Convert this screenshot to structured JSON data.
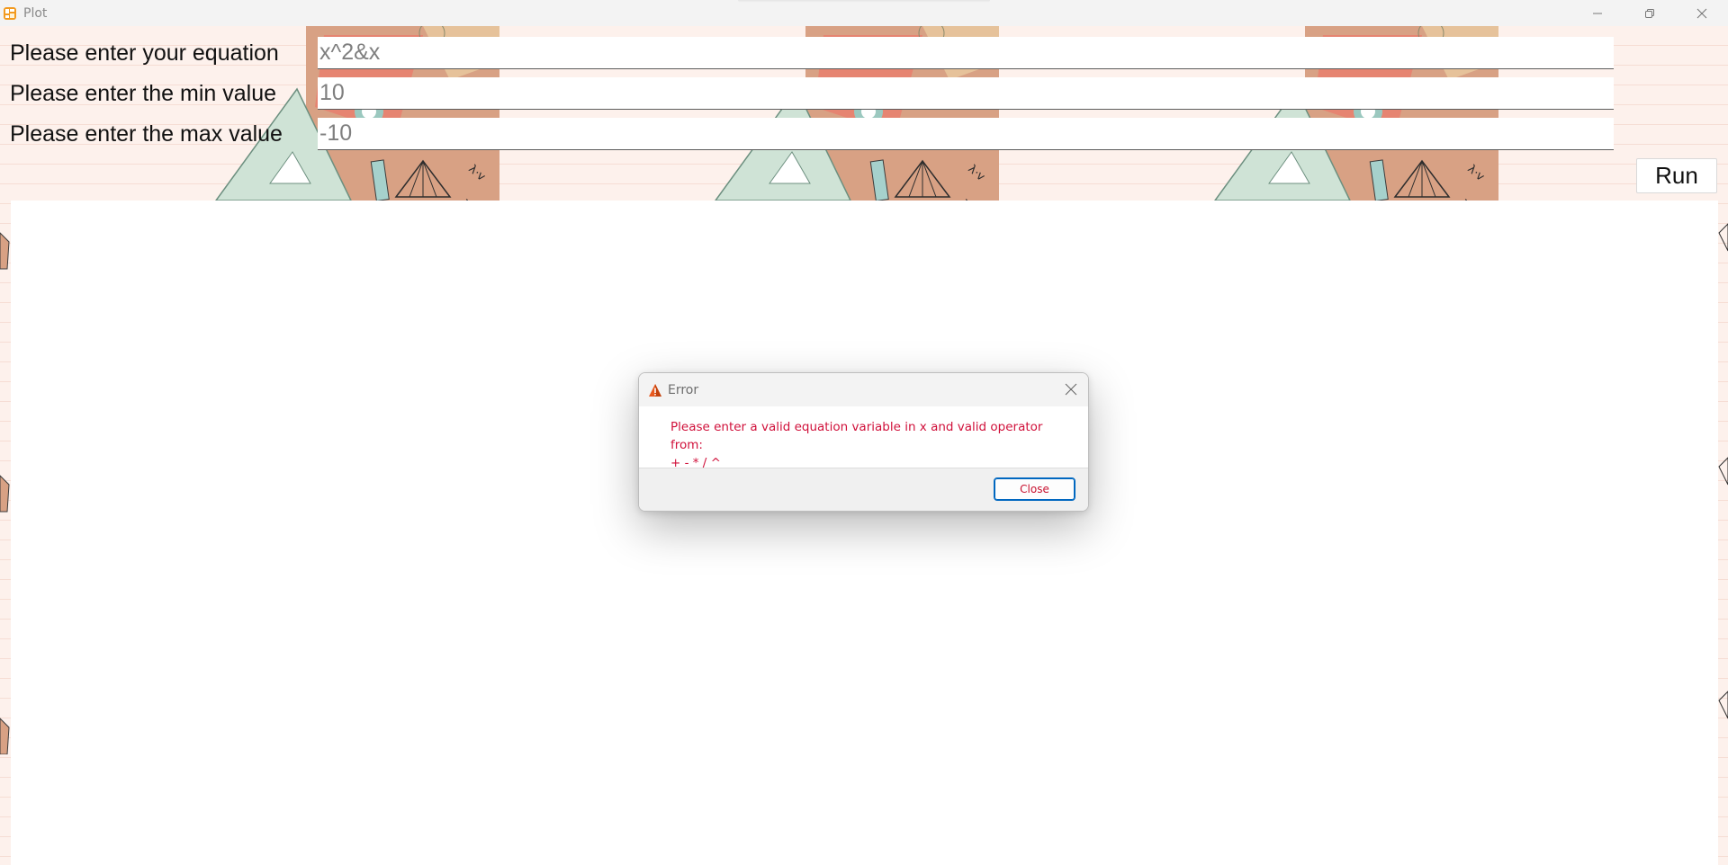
{
  "window": {
    "title": "Plot",
    "app_icon": "plot-app-icon",
    "controls": [
      "minimize-icon",
      "restore-icon",
      "close-icon"
    ]
  },
  "form": {
    "equation": {
      "label": "Please enter your equation",
      "value": "x^2&x"
    },
    "min": {
      "label": "Please enter the min value",
      "value": "10"
    },
    "max": {
      "label": "Please enter the max value",
      "value": "-10"
    },
    "run_label": "Run"
  },
  "dialog": {
    "title": "Error",
    "icon": "warning-icon",
    "message_line1": "Please enter a valid equation variable in x and valid operator from:",
    "message_line2": "+ - * / ^",
    "close_label": "Close"
  },
  "colors": {
    "background": "#fdf1ec",
    "error_text": "#d0103a",
    "focus_border": "#0067c0"
  }
}
